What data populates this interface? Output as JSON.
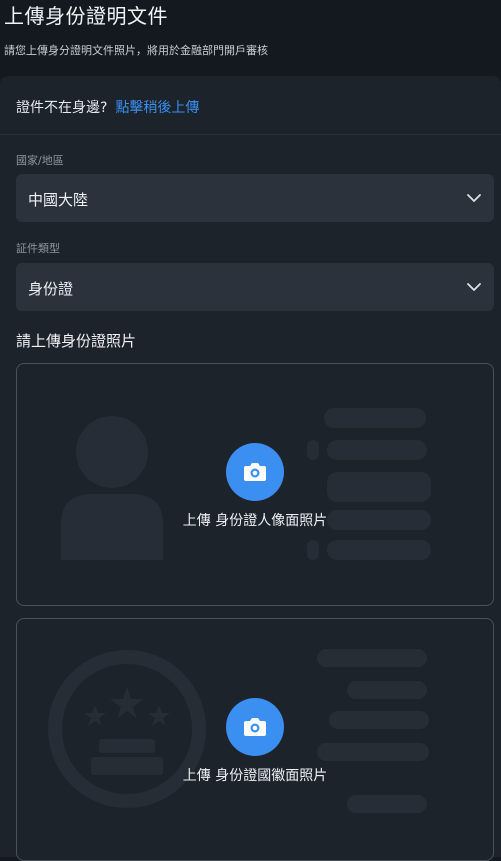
{
  "header": {
    "title": "上傳身份證明文件",
    "subtitle": "請您上傳身分證明文件照片，將用於金融部門開戶審核"
  },
  "later": {
    "question": "證件不在身邊?",
    "link": "點擊稍後上傳"
  },
  "country": {
    "label": "國家/地區",
    "value": "中國大陸"
  },
  "doc_type": {
    "label": "証件類型",
    "value": "身份證"
  },
  "upload": {
    "section_title": "請上傳身份證照片",
    "front_label": "上傳 身份證人像面照片",
    "back_label": "上傳 身份證國徽面照片"
  },
  "colors": {
    "accent": "#3a8ff0",
    "background": "#14191f",
    "panel": "#1d232b",
    "field": "#2b323c"
  },
  "icons": [
    "chevron-down-icon",
    "camera-icon"
  ]
}
